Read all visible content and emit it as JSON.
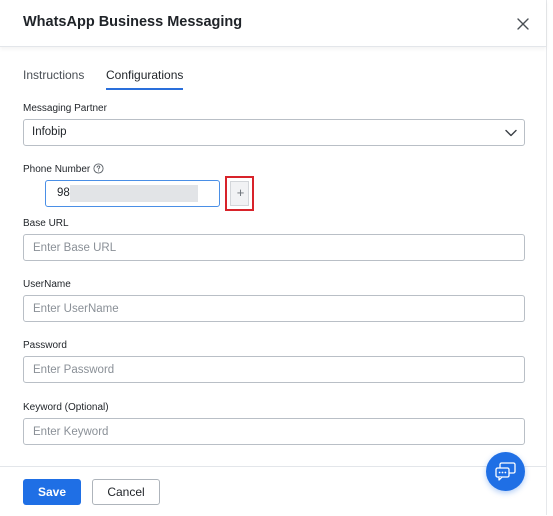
{
  "dialog": {
    "title": "WhatsApp Business Messaging"
  },
  "tabs": [
    {
      "label": "Instructions",
      "active": false
    },
    {
      "label": "Configurations",
      "active": true
    }
  ],
  "form": {
    "messaging_partner": {
      "label": "Messaging Partner",
      "value": "Infobip"
    },
    "phone_number": {
      "label": "Phone Number",
      "value": "98"
    },
    "base_url": {
      "label": "Base URL",
      "placeholder": "Enter Base URL",
      "value": ""
    },
    "username": {
      "label": "UserName",
      "placeholder": "Enter UserName",
      "value": ""
    },
    "password": {
      "label": "Password",
      "placeholder": "Enter Password",
      "value": ""
    },
    "keyword": {
      "label": "Keyword (Optional)",
      "placeholder": "Enter Keyword",
      "value": ""
    }
  },
  "footer": {
    "save_label": "Save",
    "cancel_label": "Cancel"
  },
  "icons": {
    "close": "close-icon",
    "chevron": "chevron-down-icon",
    "help": "question-circle-icon",
    "add": "plus-icon",
    "chat": "chat-support-icon"
  },
  "colors": {
    "accent": "#1f6fe5",
    "highlight_outline": "#d8232a",
    "focus_border": "#4a8fe6"
  }
}
